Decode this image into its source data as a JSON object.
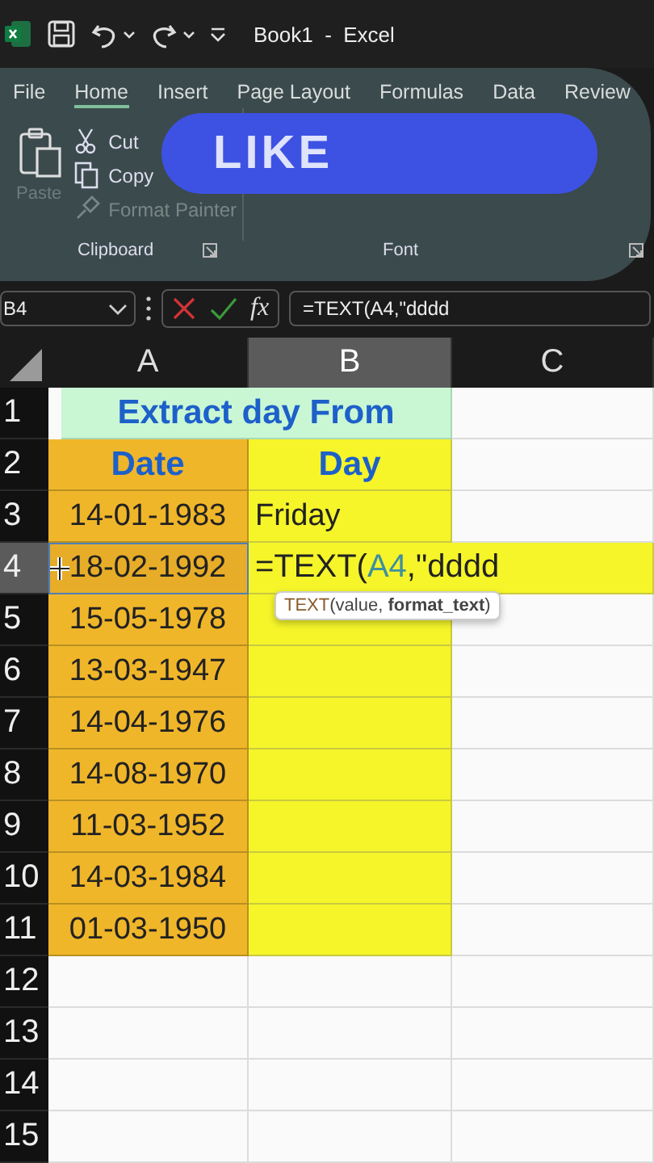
{
  "title_bar": {
    "title": "Book1  -  Excel"
  },
  "ribbon": {
    "tabs": [
      {
        "label": "File",
        "selected": false
      },
      {
        "label": "Home",
        "selected": true
      },
      {
        "label": "Insert",
        "selected": false
      },
      {
        "label": "Page Layout",
        "selected": false
      },
      {
        "label": "Formulas",
        "selected": false
      },
      {
        "label": "Data",
        "selected": false
      },
      {
        "label": "Review",
        "selected": false
      }
    ],
    "paste": {
      "label": "Paste",
      "disabled": true
    },
    "commands": [
      {
        "kind": "cut",
        "label": "Cut",
        "disabled": false
      },
      {
        "kind": "copy",
        "label": "Copy",
        "disabled": false
      },
      {
        "kind": "painter",
        "label": "Format Painter",
        "disabled": true
      }
    ],
    "groups": [
      "Clipboard",
      "Font"
    ]
  },
  "overlay": {
    "label": "LIKE"
  },
  "formula_bar": {
    "name_box": "B4",
    "function_button": "fx",
    "formula": "=TEXT(A4,\"dddd"
  },
  "columns": [
    {
      "label": "A",
      "selected": false
    },
    {
      "label": "B",
      "selected": true
    },
    {
      "label": "C",
      "selected": false
    }
  ],
  "rows": [
    {
      "number": "1",
      "selected": false,
      "kind": "title",
      "text": "Extract day From"
    },
    {
      "number": "2",
      "selected": false,
      "kind": "header",
      "date": "Date",
      "day": "Day"
    },
    {
      "number": "3",
      "selected": false,
      "kind": "data",
      "date": "14-01-1983",
      "day": "Friday"
    },
    {
      "number": "4",
      "selected": true,
      "kind": "editing",
      "date": "18-02-1992",
      "edit": {
        "prefix": "=TEXT(",
        "ref": "A4",
        "suffix": ",\"dddd"
      },
      "tooltip": {
        "function": "TEXT",
        "args": "(value, **format_text**)"
      }
    },
    {
      "number": "5",
      "selected": false,
      "kind": "data",
      "date": "15-05-1978"
    },
    {
      "number": "6",
      "selected": false,
      "kind": "data",
      "date": "13-03-1947"
    },
    {
      "number": "7",
      "selected": false,
      "kind": "data",
      "date": "14-04-1976"
    },
    {
      "number": "8",
      "selected": false,
      "kind": "data",
      "date": "14-08-1970"
    },
    {
      "number": "9",
      "selected": false,
      "kind": "data",
      "date": "11-03-1952"
    },
    {
      "number": "10",
      "selected": false,
      "kind": "data",
      "date": "14-03-1984"
    },
    {
      "number": "11",
      "selected": false,
      "kind": "data",
      "date": "01-03-1950"
    },
    {
      "number": "12",
      "selected": false,
      "kind": "empty"
    },
    {
      "number": "13",
      "selected": false,
      "kind": "empty"
    },
    {
      "number": "14",
      "selected": false,
      "kind": "empty"
    },
    {
      "number": "15",
      "selected": false,
      "kind": "empty"
    }
  ]
}
